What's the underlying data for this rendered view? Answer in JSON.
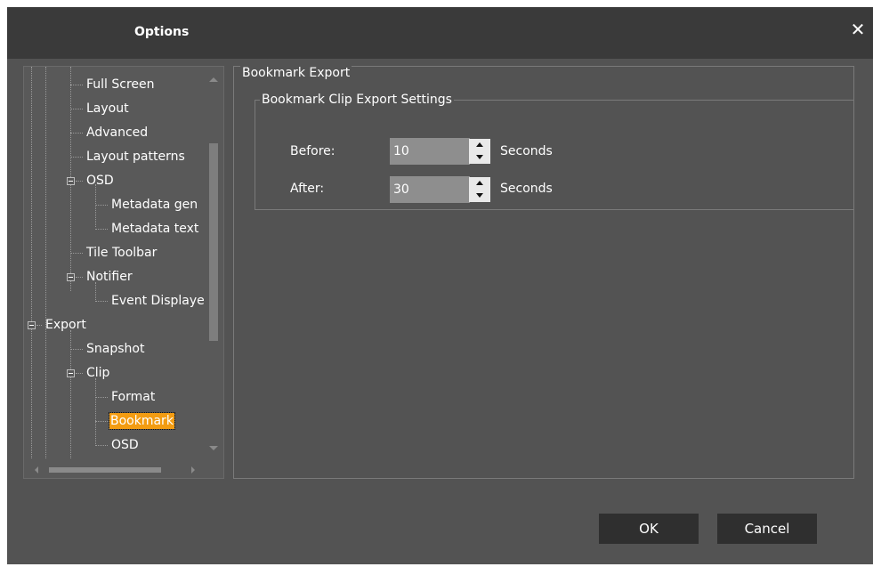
{
  "window": {
    "title": "Options",
    "close_glyph": "✕"
  },
  "tree": {
    "items": [
      {
        "label": "Full Screen"
      },
      {
        "label": "Layout"
      },
      {
        "label": "Advanced"
      },
      {
        "label": "Layout patterns"
      },
      {
        "label": "OSD"
      },
      {
        "label": "Metadata gen"
      },
      {
        "label": "Metadata text"
      },
      {
        "label": "Tile Toolbar"
      },
      {
        "label": "Notifier"
      },
      {
        "label": "Event Displaye"
      },
      {
        "label": "Export"
      },
      {
        "label": "Snapshot"
      },
      {
        "label": "Clip"
      },
      {
        "label": "Format"
      },
      {
        "label": "Bookmark"
      },
      {
        "label": "OSD"
      }
    ],
    "selected": "Bookmark"
  },
  "panel": {
    "outer_group_label": "Bookmark Export",
    "inner_group_label": "Bookmark Clip Export Settings",
    "before": {
      "label": "Before:",
      "value": "10",
      "unit": "Seconds"
    },
    "after": {
      "label": "After:",
      "value": "30",
      "unit": "Seconds"
    }
  },
  "buttons": {
    "ok": "OK",
    "cancel": "Cancel"
  },
  "colors": {
    "selection": "#f39c12",
    "dialog_bg": "#535353",
    "titlebar_bg": "#3a3a3a"
  }
}
